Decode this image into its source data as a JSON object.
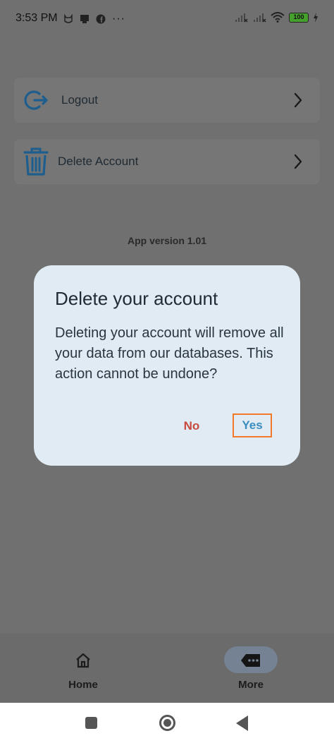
{
  "status_bar": {
    "time": "3:53 PM",
    "more_indicator": "···",
    "battery_level": "100",
    "icons_left": [
      "cat-notification-icon",
      "chat-notification-icon",
      "facebook-icon"
    ],
    "icons_right": [
      "signal-icon",
      "signal-icon-2",
      "wifi-icon",
      "battery-icon",
      "charging-icon"
    ]
  },
  "menu": {
    "items": [
      {
        "label": "Logout",
        "icon": "logout-icon"
      },
      {
        "label": "Delete Account",
        "icon": "trash-icon"
      }
    ]
  },
  "app_version": "App version 1.01",
  "dialog": {
    "title": "Delete your account",
    "body": "Deleting your account will remove all your data from our databases. This action cannot be undone?",
    "no_label": "No",
    "yes_label": "Yes"
  },
  "bottom_nav": {
    "items": [
      {
        "label": "Home",
        "icon": "home-icon"
      },
      {
        "label": "More",
        "icon": "more-icon",
        "active": true
      }
    ]
  },
  "colors": {
    "accent": "#3a8dc0",
    "danger": "#c84a3c",
    "dialog_bg": "#e0ebf3",
    "highlight": "#f07a2a"
  }
}
